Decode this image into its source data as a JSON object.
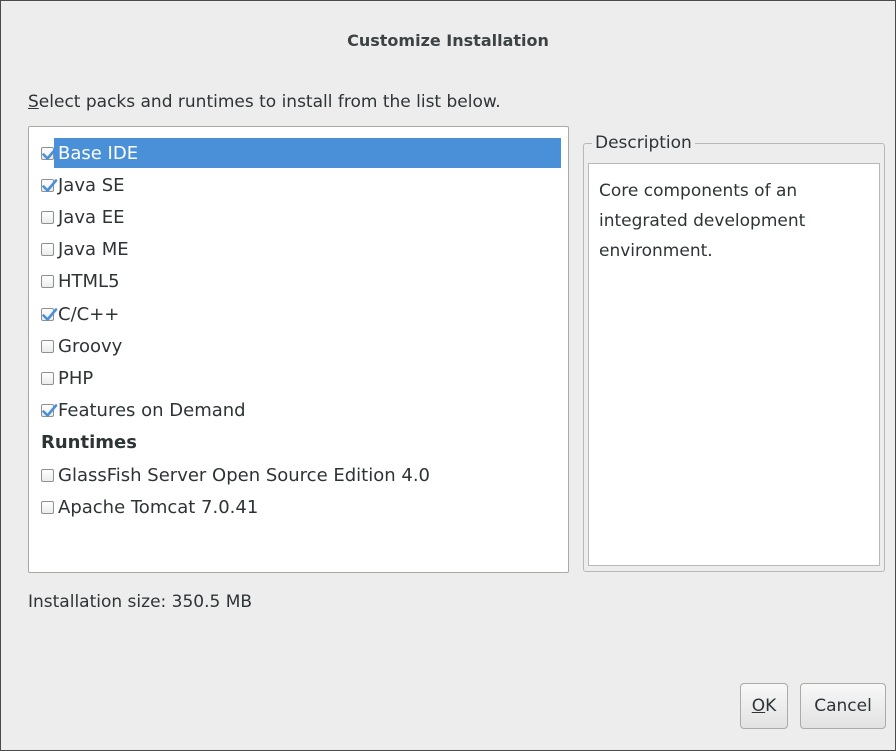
{
  "dialog": {
    "title": "Customize Installation",
    "instruction_mnemonic": "S",
    "instruction_rest": "elect packs and runtimes to install from the list below."
  },
  "packs": [
    {
      "label": "Base IDE",
      "checked": true,
      "selected": true
    },
    {
      "label": "Java SE",
      "checked": true,
      "selected": false
    },
    {
      "label": "Java EE",
      "checked": false,
      "selected": false
    },
    {
      "label": "Java ME",
      "checked": false,
      "selected": false
    },
    {
      "label": "HTML5",
      "checked": false,
      "selected": false
    },
    {
      "label": "C/C++",
      "checked": true,
      "selected": false
    },
    {
      "label": "Groovy",
      "checked": false,
      "selected": false
    },
    {
      "label": "PHP",
      "checked": false,
      "selected": false
    },
    {
      "label": "Features on Demand",
      "checked": true,
      "selected": false
    }
  ],
  "runtimes_header": "Runtimes",
  "runtimes": [
    {
      "label": "GlassFish Server Open Source Edition 4.0",
      "checked": false,
      "selected": false
    },
    {
      "label": "Apache Tomcat 7.0.41",
      "checked": false,
      "selected": false
    }
  ],
  "description": {
    "legend": "Description",
    "text": "Core components of an integrated development environment."
  },
  "installation_size": "Installation size: 350.5 MB",
  "buttons": {
    "ok_mnemonic": "O",
    "ok_rest": "K",
    "cancel_label": "Cancel"
  },
  "colors": {
    "selection": "#4a90d9",
    "check": "#4a90d9"
  },
  "icons": {
    "checked": "checkmark-icon"
  }
}
